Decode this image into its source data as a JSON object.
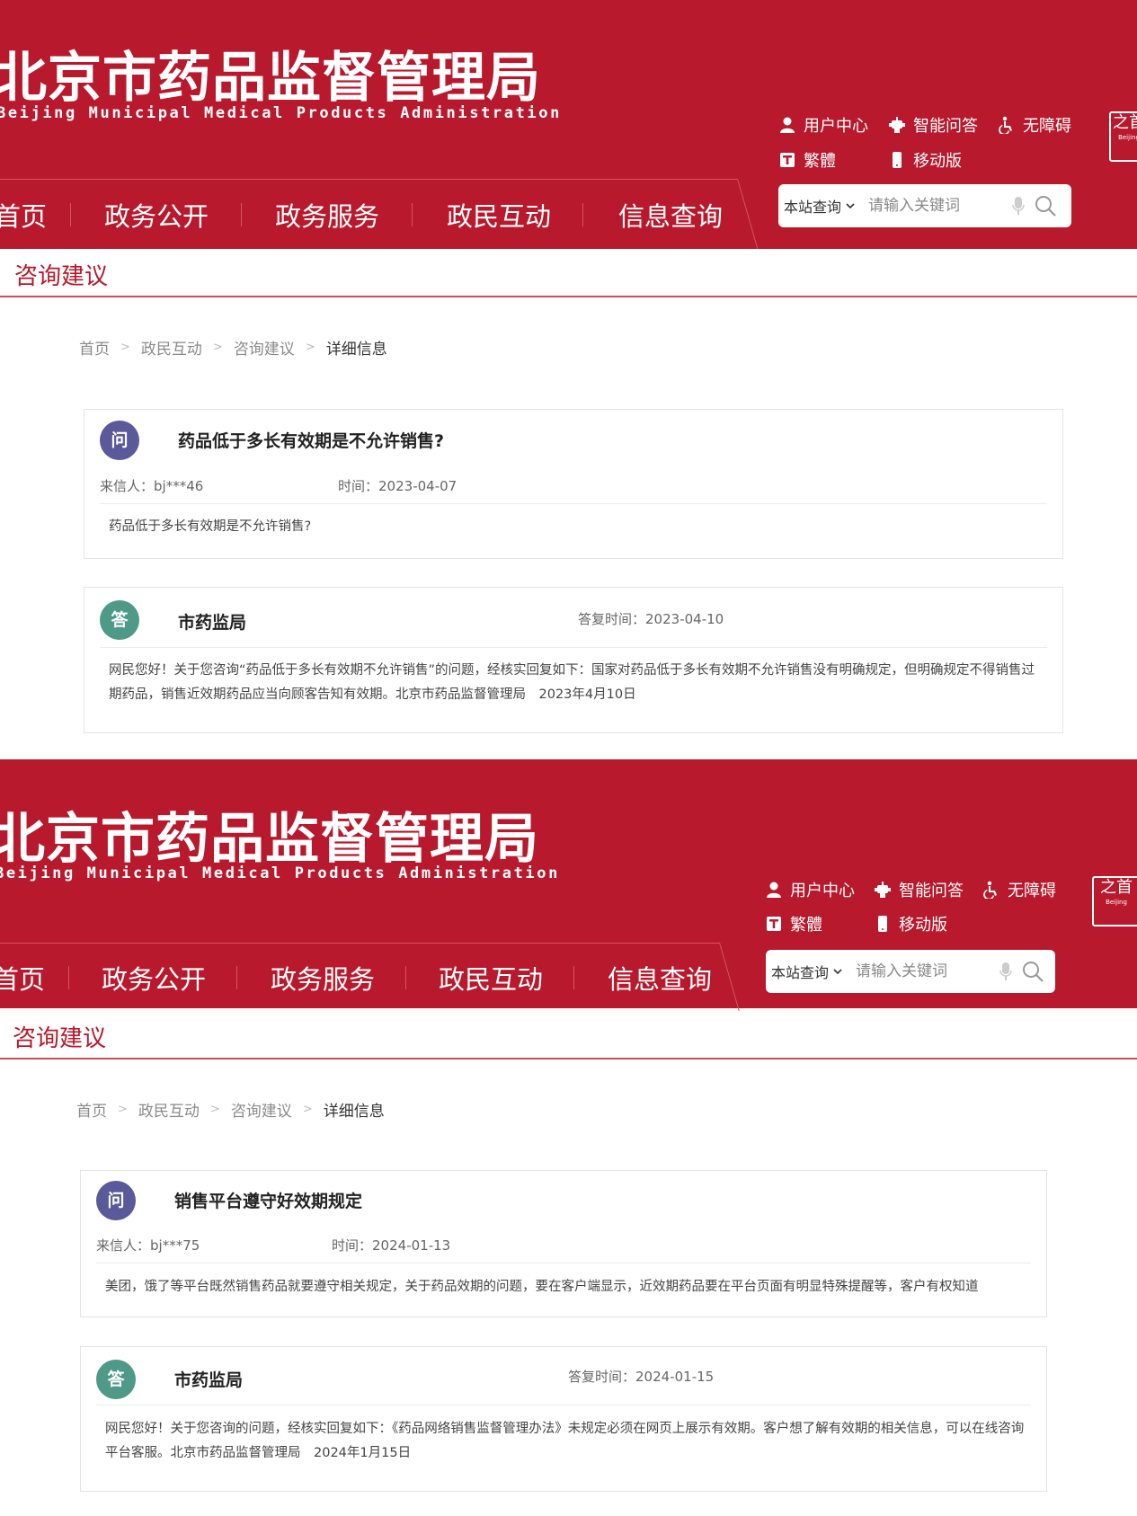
{
  "site": {
    "title": "北京市药品监督管理局",
    "subtitle": "Beijing Municipal Medical Products Administration"
  },
  "utility": {
    "user_center": "用户中心",
    "smart_qa": "智能问答",
    "accessibility": "无障碍",
    "traditional": "繁體",
    "mobile": "移动版"
  },
  "emblem": {
    "top": "之首",
    "bottom": "Beijing"
  },
  "nav": [
    "首页",
    "政务公开",
    "政务服务",
    "政民互动",
    "信息查询"
  ],
  "search": {
    "scope": "本站查询",
    "placeholder": "请输入关键词"
  },
  "section_title": "咨询建议",
  "breadcrumb": {
    "home": "首页",
    "level1": "政民互动",
    "level2": "咨询建议",
    "current": "详细信息"
  },
  "meta_labels": {
    "sender": "来信人：",
    "time": "时间：",
    "reply_time": "答复时间：",
    "q_badge": "问",
    "a_badge": "答"
  },
  "records": [
    {
      "question": {
        "title": "药品低于多长有效期是不允许销售?",
        "sender": "bj***46",
        "time": "2023-04-07",
        "content": "药品低于多长有效期是不允许销售?"
      },
      "answer": {
        "org": "市药监局",
        "reply_time": "2023-04-10",
        "content": "网民您好！关于您咨询“药品低于多长有效期不允许销售”的问题，经核实回复如下：国家对药品低于多长有效期不允许销售没有明确规定，但明确规定不得销售过期药品，销售近效期药品应当向顾客告知有效期。北京市药品监督管理局　2023年4月10日"
      }
    },
    {
      "question": {
        "title": "销售平台遵守好效期规定",
        "sender": "bj***75",
        "time": "2024-01-13",
        "content": "美团，饿了等平台既然销售药品就要遵守相关规定，关于药品效期的问题，要在客户端显示，近效期药品要在平台页面有明显特殊提醒等，客户有权知道"
      },
      "answer": {
        "org": "市药监局",
        "reply_time": "2024-01-15",
        "content": "网民您好！关于您咨询的问题，经核实回复如下：《药品网络销售监督管理办法》未规定必须在网页上展示有效期。客户想了解有效期的相关信息，可以在线咨询平台客服。北京市药品监督管理局　2024年1月15日"
      }
    }
  ],
  "colors": {
    "brand_red": "#b8192c",
    "question_badge": "#5a5a9a",
    "answer_badge": "#4f9988"
  },
  "icons": [
    "user-icon",
    "robot-icon",
    "wheelchair-icon",
    "traditional-t-icon",
    "mobile-icon",
    "chevron-down-icon",
    "microphone-icon",
    "search-icon"
  ]
}
